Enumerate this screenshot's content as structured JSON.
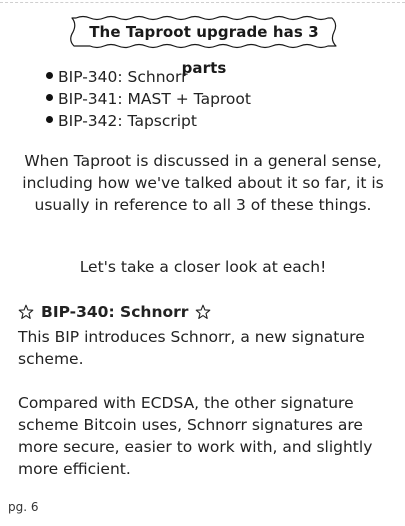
{
  "title": "The Taproot upgrade has 3 parts",
  "bullets": [
    "BIP-340: Schnorr",
    "BIP-341: MAST + Taproot",
    "BIP-342: Tapscript"
  ],
  "intro": "When Taproot is discussed in a general sense, including how we've talked about it so far, it is usually in reference to all 3 of these things.",
  "cta": "Let's take a closer look at each!",
  "section": {
    "heading": "BIP-340: Schnorr",
    "paragraphs": [
      "This BIP introduces Schnorr, a new signature scheme.",
      "Compared with ECDSA, the other signature scheme Bitcoin uses, Schnorr signatures are more secure, easier to work with, and slightly more efficient."
    ]
  },
  "page_number": "pg. 6"
}
